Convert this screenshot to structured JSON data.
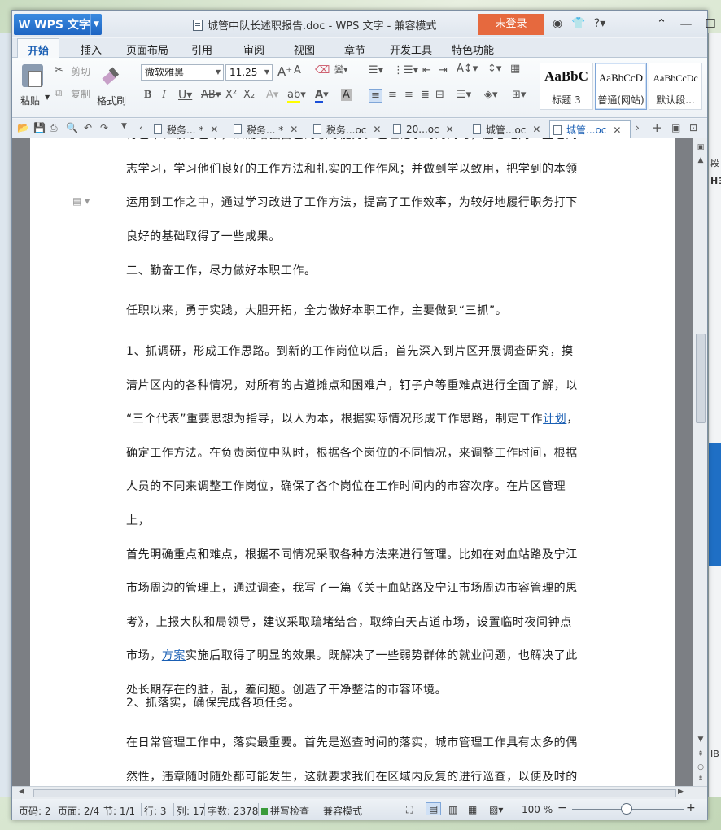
{
  "window": {
    "app_name": "WPS 文字",
    "title": "城管中队长述职报告.doc - WPS 文字 - 兼容模式",
    "login_label": "未登录"
  },
  "ribbon_tabs": [
    "开始",
    "插入",
    "页面布局",
    "引用",
    "审阅",
    "视图",
    "章节",
    "开发工具",
    "特色功能"
  ],
  "ribbon": {
    "paste": "粘贴",
    "cut": "剪切",
    "copy": "复制",
    "format_painter": "格式刷",
    "font_name": "微软雅黑",
    "font_size": "11.25",
    "styles": [
      {
        "sample": "AaBbC",
        "name": "标题 3"
      },
      {
        "sample": "AaBbCcD",
        "name": "普通(网站)"
      },
      {
        "sample": "AaBbCcDc",
        "name": "默认段..."
      }
    ]
  },
  "doc_tabs": [
    {
      "label": "税务... *",
      "active": false
    },
    {
      "label": "税务... *",
      "active": false
    },
    {
      "label": "税务...oc",
      "active": false
    },
    {
      "label": "20...oc",
      "active": false
    },
    {
      "label": "城管...oc",
      "active": false
    },
    {
      "label": "城管...oc",
      "active": true
    }
  ],
  "document": {
    "paragraphs": [
      {
        "lines": [
          "行艺术、领导艺术，从而增强自己的领导能力。在理论学习的同时，虚心地向一些老同",
          "志学习，学习他们良好的工作方法和扎实的工作作风；并做到学以致用，把学到的本领",
          "运用到工作之中，通过学习改进了工作方法，提高了工作效率，为较好地履行职务打下",
          "良好的基础取得了一些成果。"
        ]
      },
      {
        "lines": [
          "二、勤奋工作，尽力做好本职工作。"
        ]
      },
      {
        "lines": [
          "任职以来，勇于实践，大胆开拓，全力做好本职工作，主要做到“三抓”。"
        ]
      },
      {
        "lines": [
          "1、抓调研，形成工作思路。到新的工作岗位以后，首先深入到片区开展调查研究，摸",
          "清片区内的各种情况，对所有的占道摊点和困难户，钉子户等重难点进行全面了解，以",
          "“三个代表”重要思想为指导，以人为本，根据实际情况形成工作思路，制定工作",
          "确定工作方法。在负责岗位中队时，根据各个岗位的不同情况，来调整工作时间，根据",
          "人员的不同来调整工作岗位，确保了各个岗位在工作时间内的市容次序。在片区管理上，",
          "首先明确重点和难点，根据不同情况采取各种方法来进行管理。比如在对血站路及宁江",
          "市场周边的管理上，通过调查，我写了一篇《关于血站路及宁江市场周边市容管理的思",
          "考》，上报大队和局领导，建议采取疏堵结合，取缔白天占道市场，设置临时夜间钟点",
          "市场，",
          "处长期存在的脏，乱，差问题。创造了干净整洁的市容环境。"
        ]
      },
      {
        "lines": [
          "2、抓落实，确保完成各项任务。"
        ]
      },
      {
        "lines": [
          "在日常管理工作中，落实最重要。首先是巡查时间的落实，城市管理工作具有太多的偶",
          "然性，违章随时随处都可能发生，这就要求我们在区域内反复的进行巡查，以便及时的"
        ]
      }
    ],
    "link_plan": "计划",
    "link_plan_suffix": "，",
    "link_scheme": "方案",
    "scheme_suffix": "实施后取得了明显的效果。既解决了一些弱势群体的就业问题，也解决了此"
  },
  "status": {
    "page_num": "页码: 2",
    "pages": "页面: 2/4",
    "section": "节: 1/1",
    "row": "行: 3",
    "col": "列: 17",
    "word_count": "字数: 2378",
    "spell_check": "拼写检查",
    "compat": "兼容模式",
    "zoom": "100 %"
  },
  "background": {
    "right_text_1": "段",
    "right_text_2": "H3",
    "right_text_3": "IB"
  }
}
